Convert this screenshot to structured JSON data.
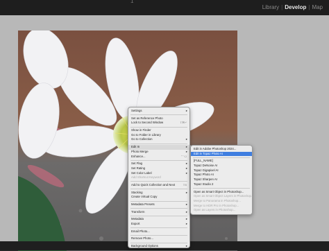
{
  "window": {
    "top_mark": "1"
  },
  "modules": [
    "Library",
    "Develop",
    "Map"
  ],
  "active_module": "Develop",
  "context_menu": {
    "items": [
      {
        "label": "Settings",
        "arrow": true,
        "disabled": false
      },
      {
        "divider": true
      },
      {
        "label": "Set as Reference Photo",
        "disabled": false
      },
      {
        "label": "Lock to Second Window",
        "shortcut": "⇧⌘↵",
        "disabled": false
      },
      {
        "divider": true
      },
      {
        "label": "Show in Finder",
        "disabled": false
      },
      {
        "label": "Go to Folder in Library",
        "disabled": false
      },
      {
        "label": "Go to Collection",
        "arrow": true,
        "disabled": false
      },
      {
        "divider": true
      },
      {
        "label": "Edit In",
        "arrow": true,
        "highlighted": true
      },
      {
        "label": "Photo Merge",
        "arrow": true,
        "disabled": false
      },
      {
        "label": "Enhance...",
        "shortcut": "⌃⌥I",
        "disabled": false
      },
      {
        "divider": true
      },
      {
        "label": "Set Flag",
        "arrow": true,
        "disabled": false
      },
      {
        "label": "Set Rating",
        "arrow": true,
        "disabled": false
      },
      {
        "label": "Set Color Label",
        "arrow": true,
        "disabled": false
      },
      {
        "label": "Add Shortcut Keyword",
        "disabled": true
      },
      {
        "divider": true
      },
      {
        "label": "Add to Quick Collection and Next",
        "shortcut": "⇧B",
        "disabled": false
      },
      {
        "divider": true
      },
      {
        "label": "Stacking",
        "arrow": true,
        "disabled": false
      },
      {
        "label": "Create Virtual Copy",
        "disabled": false
      },
      {
        "divider": true
      },
      {
        "label": "Metadata Presets",
        "arrow": true,
        "disabled": false
      },
      {
        "divider": true
      },
      {
        "label": "Transform",
        "arrow": true,
        "disabled": false
      },
      {
        "divider": true
      },
      {
        "label": "Metadata",
        "arrow": true,
        "disabled": false
      },
      {
        "label": "Export",
        "arrow": true,
        "disabled": false
      },
      {
        "divider": true
      },
      {
        "label": "Email Photo...",
        "disabled": false
      },
      {
        "divider": true
      },
      {
        "label": "Remove Photo...",
        "disabled": false
      },
      {
        "divider": true
      },
      {
        "label": "Background Options",
        "arrow": true,
        "disabled": false
      }
    ]
  },
  "edit_in_submenu": {
    "items": [
      {
        "label": "Edit in Adobe Photoshop 2024...",
        "disabled": false
      },
      {
        "label": "Edit in Topaz Photo AI",
        "selected": true
      },
      {
        "divider": true
      },
      {
        "label": "[FULL_NAME]",
        "disabled": false
      },
      {
        "label": "Topaz DeNoise AI",
        "disabled": false
      },
      {
        "label": "Topaz Gigapixel AI",
        "disabled": false
      },
      {
        "label": "Topaz Photo AI",
        "disabled": false
      },
      {
        "label": "Topaz Sharpen AI",
        "disabled": false
      },
      {
        "label": "Topaz Studio 2",
        "disabled": false
      },
      {
        "divider": true
      },
      {
        "label": "Open as Smart Object in Photoshop...",
        "disabled": false
      },
      {
        "label": "Open as Smart Object Layers in Photoshop...",
        "disabled": true
      },
      {
        "label": "Merge to Panorama in Photoshop...",
        "disabled": true
      },
      {
        "label": "Merge to HDR Pro in Photoshop...",
        "disabled": true
      },
      {
        "label": "Open as Layers in Photoshop...",
        "disabled": true
      }
    ]
  }
}
